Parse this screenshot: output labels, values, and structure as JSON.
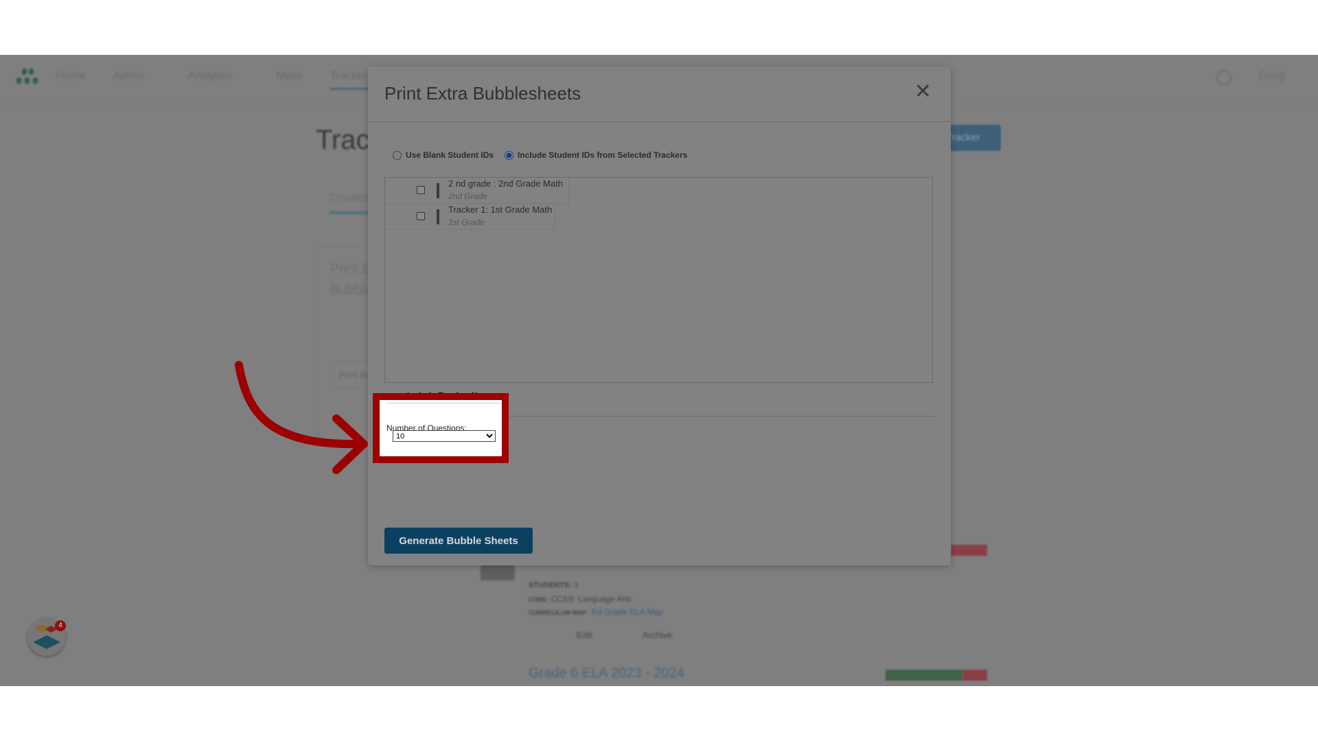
{
  "nav": {
    "items": [
      "Home",
      "Admin",
      "Analytics",
      "Maps",
      "Trackers"
    ],
    "help_icon": "question-circle-icon",
    "user": "Doug"
  },
  "background": {
    "page_title": "Trackers",
    "tab": "Created",
    "card_title": "Print Extra Bubblesheets",
    "card_button": "Print Bubblesheets",
    "tracker_meta": {
      "students_label": "STUDENTS:",
      "students": "3",
      "core_label": "CORE:",
      "core": "CCSS: Language Arts",
      "map_label": "CURRICULUM MAP:",
      "map": "3rd Grade ELA Map"
    },
    "actions": [
      "Edit",
      "Archive"
    ],
    "next_tracker": "Grade 6 ELA 2023 - 2024",
    "new_button": "New Tracker"
  },
  "modal": {
    "title": "Print Extra Bubblesheets",
    "radio_blank": "Use Blank Student IDs",
    "radio_include": "Include Student IDs from Selected Trackers",
    "selected_radio": "include",
    "trackers": [
      {
        "name": "2 nd grade : 2nd Grade Math",
        "grade": "2nd Grade",
        "checked": false
      },
      {
        "name": "Tracker 1: 1st Grade Math",
        "grade": "1st Grade",
        "checked": false
      }
    ],
    "include_teacher": "Include Teacher Name",
    "num_questions_label": "Number of Questions:",
    "num_questions_value": "10",
    "generate": "Generate Bubble Sheets"
  },
  "annotation": {
    "highlight_color": "#9c0000",
    "badge_count": "4"
  }
}
